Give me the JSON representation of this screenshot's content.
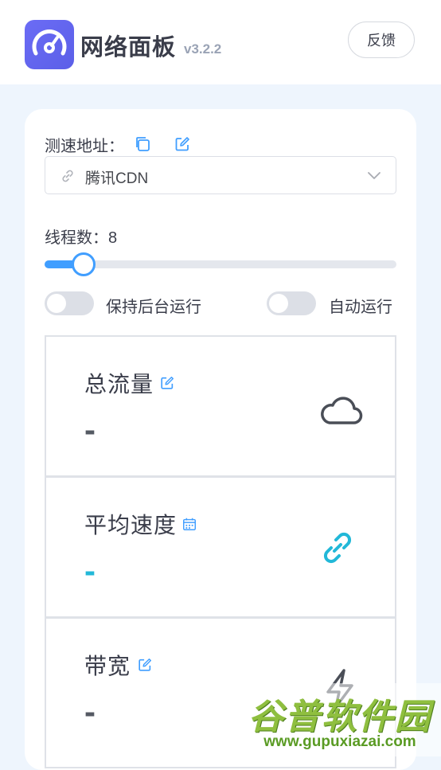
{
  "header": {
    "title": "网络面板",
    "version": "v3.2.2",
    "feedback_label": "反馈"
  },
  "settings": {
    "speedtest_address_label": "测速地址：",
    "speedtest_address_value": "腾讯CDN",
    "threads_label": "线程数：",
    "threads_value": "8",
    "threads_slider_fraction": 0.11,
    "keep_background_label": "保持后台运行",
    "keep_background_on": false,
    "auto_run_label": "自动运行",
    "auto_run_on": false
  },
  "stats": [
    {
      "title": "总流量",
      "value": "-",
      "icon": "cloud-icon",
      "value_color": "#555a63"
    },
    {
      "title": "平均速度",
      "value": "-",
      "icon": "link-icon",
      "value_color": "#22b8d8"
    },
    {
      "title": "带宽",
      "value": "-",
      "icon": "lightning-icon",
      "value_color": "#555a63"
    }
  ],
  "watermark": {
    "title": "谷普软件园",
    "url": "www.gupuxiazai.com"
  },
  "colors": {
    "accent": "#409eff",
    "cyan": "#22b8d8",
    "logo": "#5b5fe8"
  }
}
